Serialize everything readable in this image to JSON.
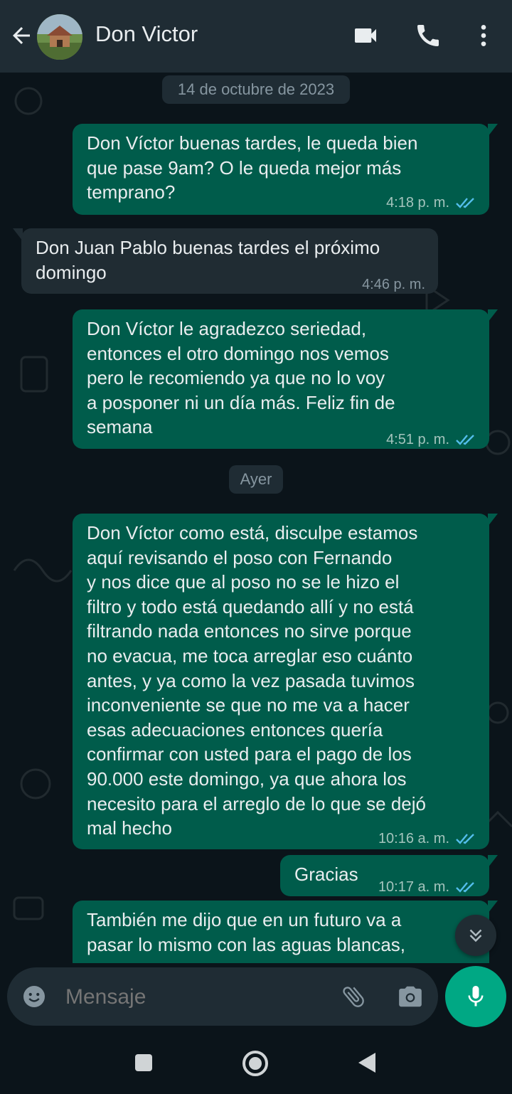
{
  "header": {
    "contact_name": "Don Victor",
    "icons": [
      "back-arrow-icon",
      "video-call-icon",
      "phone-icon",
      "more-vert-icon"
    ]
  },
  "chat": {
    "date_1": "14 de octubre de 2023",
    "date_2": "Ayer",
    "messages": [
      {
        "direction": "out",
        "lines": [
          "Don Víctor buenas tardes, le queda bien",
          "que pase 9am? O le queda mejor más",
          "temprano?"
        ],
        "time": "4:18 p. m.",
        "status": "read"
      },
      {
        "direction": "in",
        "lines": [
          "Don Juan Pablo buenas tardes el próximo",
          "domingo"
        ],
        "time": "4:46 p. m."
      },
      {
        "direction": "out",
        "lines": [
          "Don Víctor le agradezco seriedad,",
          "entonces el otro domingo nos vemos",
          "pero le recomiendo ya que no lo voy",
          "a posponer ni un día más. Feliz fin de",
          "semana"
        ],
        "time": "4:51 p. m.",
        "status": "read"
      },
      {
        "direction": "out",
        "lines": [
          "Don Víctor como está, disculpe estamos",
          "aquí revisando el poso con Fernando",
          "y nos dice que al poso no se le hizo el",
          "filtro y todo está quedando allí y no está",
          "filtrando nada entonces no sirve porque",
          "no evacua, me toca arreglar eso cuánto",
          "antes, y ya como la vez pasada tuvimos",
          "inconveniente se que no me va a hacer",
          "esas adecuaciones entonces quería",
          "confirmar con usted para el pago de los",
          "90.000 este domingo, ya que ahora los",
          "necesito para el arreglo de lo que se dejó",
          "mal hecho"
        ],
        "time": "10:16 a. m.",
        "status": "read"
      },
      {
        "direction": "out",
        "lines": [
          "Gracias"
        ],
        "time": "10:17 a. m.",
        "status": "read"
      },
      {
        "direction": "out",
        "lines": [
          "También me dijo que en un futuro va a",
          "pasar lo mismo con las aguas blancas,"
        ],
        "time": "",
        "status": "read"
      }
    ]
  },
  "composer": {
    "placeholder": "Mensaje",
    "icons": [
      "emoji-icon",
      "attach-icon",
      "camera-icon",
      "mic-icon"
    ]
  },
  "colors": {
    "header_bg": "#1f2c34",
    "chat_bg": "#0b141a",
    "outgoing_bubble": "#005c4b",
    "incoming_bubble": "#202c33",
    "accent": "#00a884",
    "read_tick": "#53bdeb"
  }
}
